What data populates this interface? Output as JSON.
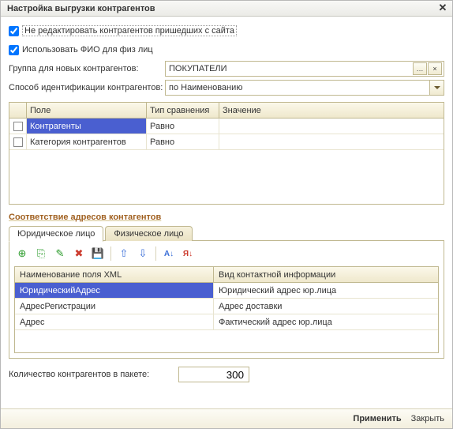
{
  "window": {
    "title": "Настройка выгрузки контрагентов"
  },
  "checkboxes": {
    "no_edit_site": {
      "label": "Не редактировать контрагентов пришедших с сайта",
      "checked": true
    },
    "use_fio": {
      "label": "Использовать ФИО для физ лиц",
      "checked": true
    }
  },
  "group_row": {
    "label": "Группа для новых контрагентов:",
    "value": "ПОКУПАТЕЛИ"
  },
  "ident_row": {
    "label": "Способ идентификации контрагентов:",
    "value": "по Наименованию"
  },
  "table1": {
    "headers": {
      "field": "Поле",
      "cmp": "Тип сравнения",
      "val": "Значение"
    },
    "rows": [
      {
        "field": "Контрагенты",
        "cmp": "Равно",
        "val": "",
        "selected": true
      },
      {
        "field": "Категория контрагентов",
        "cmp": "Равно",
        "val": "",
        "selected": false
      }
    ]
  },
  "section_title": "Соответствие адресов контагентов",
  "tabs": {
    "legal": "Юридическое лицо",
    "individual": "Физическое лицо"
  },
  "toolbar_icons": {
    "add": "add-icon",
    "copy": "copy-icon",
    "edit": "edit-icon",
    "delete": "delete-icon",
    "save": "save-icon",
    "up": "up-icon",
    "down": "down-icon",
    "sortaz": "sort-asc-icon",
    "sortza": "sort-desc-icon"
  },
  "table2": {
    "headers": {
      "xml": "Наименование поля XML",
      "kind": "Вид контактной информации"
    },
    "rows": [
      {
        "xml": "ЮридическийАдрес",
        "kind": "Юридический адрес юр.лица",
        "selected": true
      },
      {
        "xml": "АдресРегистрации",
        "kind": "Адрес доставки",
        "selected": false
      },
      {
        "xml": "Адрес",
        "kind": "Фактический адрес юр.лица",
        "selected": false
      }
    ]
  },
  "packet": {
    "label": "Количество контрагентов в пакете:",
    "value": "300"
  },
  "footer": {
    "apply": "Применить",
    "close": "Закрыть"
  }
}
